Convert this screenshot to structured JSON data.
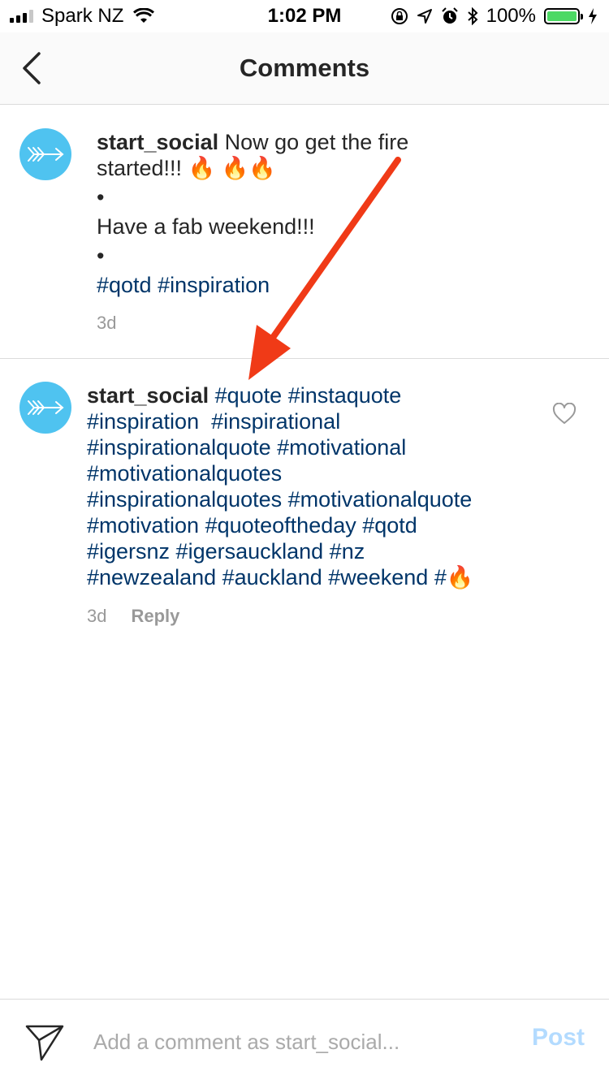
{
  "status_bar": {
    "carrier": "Spark NZ",
    "time": "1:02 PM",
    "battery": "100%"
  },
  "header": {
    "title": "Comments",
    "back_icon": "chevron-left-icon"
  },
  "comments": [
    {
      "username": "start_social",
      "line1": "Now go get the fire",
      "line2": "started!!! 🔥 🔥🔥",
      "bullet1": "•",
      "line3": "Have a fab weekend!!!",
      "bullet2": "•",
      "tags": "#qotd #inspiration",
      "time": "3d"
    },
    {
      "username": "start_social",
      "tag_lines": [
        "#quote #instaquote",
        "#inspiration  #inspirational",
        "#inspirationalquote #motivational",
        "#motivationalquotes",
        "#inspirationalquotes #motivationalquote",
        "#motivation #quoteoftheday #qotd",
        "#igersnz #igersauckland #nz",
        "#newzealand #auckland #weekend #🔥"
      ],
      "time": "3d",
      "reply_label": "Reply",
      "like_icon": "heart-outline-icon"
    }
  ],
  "composer": {
    "placeholder": "Add a comment as start_social...",
    "post_label": "Post",
    "send_icon": "paper-plane-icon"
  },
  "colors": {
    "hashtag": "#003569",
    "avatar": "#4fc3f0",
    "post_disabled": "#b3dbff",
    "annotation_arrow": "#f03a17"
  }
}
